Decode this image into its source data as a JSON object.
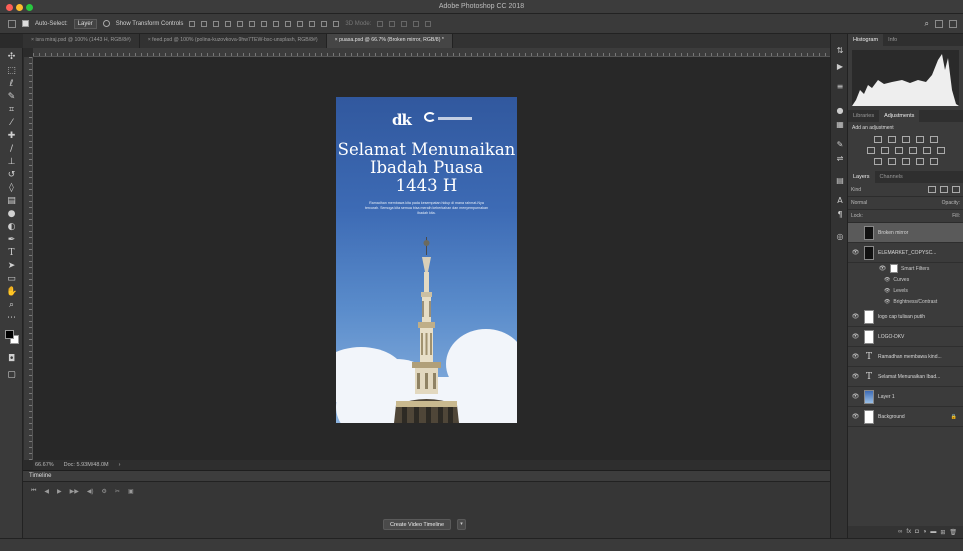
{
  "window": {
    "title": "Adobe Photoshop CC 2018",
    "traffic_colors": [
      "#fc5f57",
      "#fdbc2e",
      "#28c840"
    ]
  },
  "options": {
    "auto_select": "Auto-Select:",
    "layer_dropdown": "Layer",
    "show_transform": "Show Transform Controls",
    "mode_3d": "3D Mode:"
  },
  "tabs": [
    {
      "label": "× isra miraj.psd @ 100% (1443 H, RGB/8#)",
      "active": false
    },
    {
      "label": "× feed.psd @ 100% (polina-kuzovkova-9hw7TEW-bsc-unsplash, RGB/8#)",
      "active": false
    },
    {
      "label": "× puasa.psd @ 66.7% (Broken mirror, RGB/8) *",
      "active": true
    }
  ],
  "document": {
    "logo_text": "dk",
    "title_lines": [
      "Selamat Menunaikan",
      "Ibadah Puasa",
      "1443 H"
    ],
    "body": "Ramadhan membawa kita pada kesempatan hidup di mana rahmat-Nya tercurah. Semoga kita semua bisa meraih keberkahan dan menyempurnakan ibadah kita."
  },
  "status": {
    "zoom": "66.67%",
    "doc_size": "Doc: 5.93M/48.0M"
  },
  "timeline": {
    "header": "Timeline",
    "create_button": "Create Video Timeline"
  },
  "panels": {
    "histogram_tab": "Histogram",
    "info_tab": "Info",
    "libraries_tab": "Libraries",
    "adjustments_tab": "Adjustments",
    "add_adjustment": "Add an adjustment",
    "layers_tab": "Layers",
    "channels_tab": "Channels",
    "kind": "Kind",
    "normal": "Normal",
    "opacity": "Opacity:",
    "fill": "Fill:",
    "lock": "Lock:"
  },
  "layers": [
    {
      "name": "Broken mirror",
      "thumb": "black",
      "selected": true,
      "visible": false
    },
    {
      "name": "ELEMARKET_COPYSC...",
      "thumb": "black",
      "selected": false,
      "visible": true
    },
    {
      "name": "logo cap tulisan putih",
      "thumb": "white",
      "selected": false,
      "visible": true
    },
    {
      "name": "LOGO-DKV",
      "thumb": "white",
      "selected": false,
      "visible": true
    },
    {
      "name": "Ramadhan membawa kind...",
      "thumb": "T",
      "selected": false,
      "visible": true
    },
    {
      "name": "Selamat Menunaikan Ibad...",
      "thumb": "T",
      "selected": false,
      "visible": true
    },
    {
      "name": "Layer 1",
      "thumb": "blue",
      "selected": false,
      "visible": true
    },
    {
      "name": "Background",
      "thumb": "white",
      "selected": false,
      "visible": true
    }
  ],
  "smart_filters": {
    "label": "Smart Filters",
    "items": [
      "Curves",
      "Levels",
      "Brightness/Contrast"
    ]
  }
}
